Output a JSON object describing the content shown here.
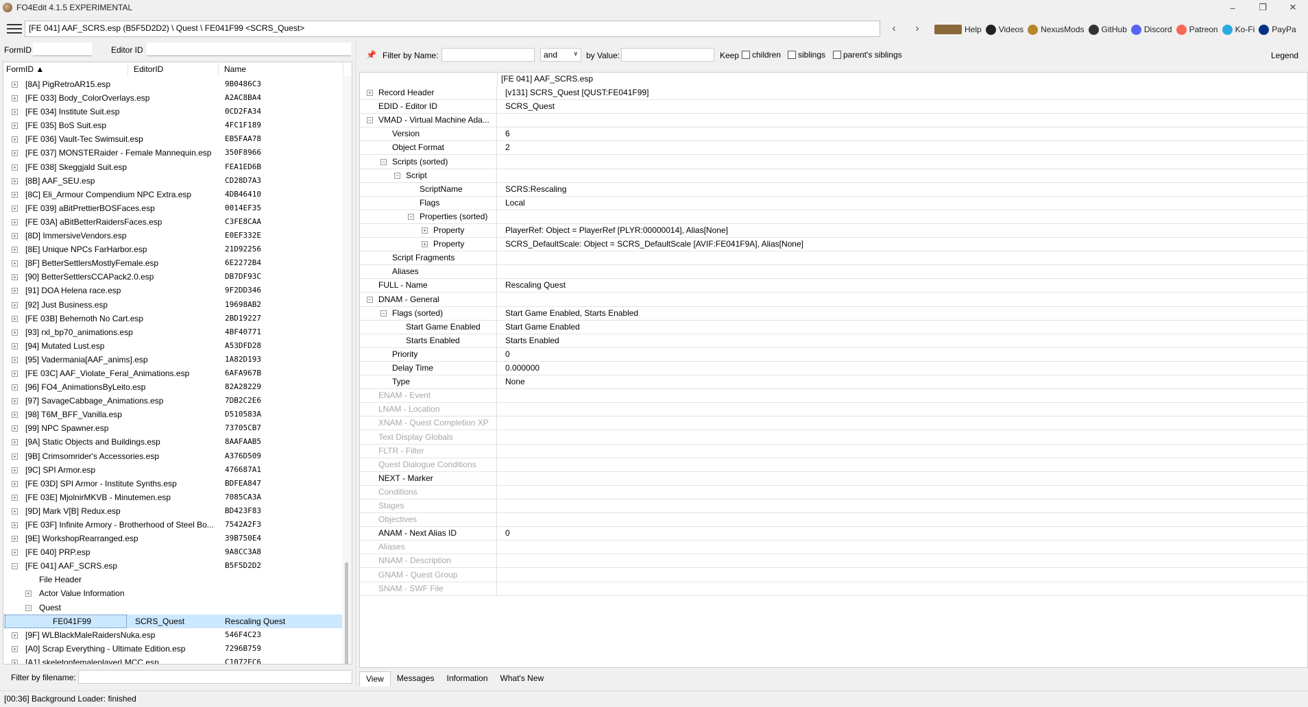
{
  "window": {
    "title": "FO4Edit 4.1.5 EXPERIMENTAL"
  },
  "pathbar": {
    "path": "[FE 041] AAF_SCRS.esp (B5F5D2D2) \\ Quest \\ FE041F99 <SCRS_Quest>"
  },
  "links": [
    {
      "label": "Help",
      "icon": "book-icon",
      "color": "#8a6a3a"
    },
    {
      "label": "Videos",
      "icon": "videos-icon",
      "color": "#222222"
    },
    {
      "label": "NexusMods",
      "icon": "nexusmods-icon",
      "color": "#b8862b"
    },
    {
      "label": "GitHub",
      "icon": "github-icon",
      "color": "#333333"
    },
    {
      "label": "Discord",
      "icon": "discord-icon",
      "color": "#5865f2"
    },
    {
      "label": "Patreon",
      "icon": "patreon-icon",
      "color": "#f96854"
    },
    {
      "label": "Ko-Fi",
      "icon": "kofi-icon",
      "color": "#29abe0"
    },
    {
      "label": "PayPa",
      "icon": "paypal-icon",
      "color": "#003087"
    }
  ],
  "left": {
    "formid_label": "FormID",
    "editorid_label": "Editor ID",
    "columns": [
      "FormID",
      "EditorID",
      "Name"
    ],
    "rows": [
      {
        "name": "[8A] PigRetroAR15.esp",
        "hex": "9B0486C3"
      },
      {
        "name": "[FE 033] Body_ColorOverlays.esp",
        "hex": "A2AC8BA4"
      },
      {
        "name": "[FE 034] Institute Suit.esp",
        "hex": "0CD2FA34"
      },
      {
        "name": "[FE 035] BoS Suit.esp",
        "hex": "4FC1F189"
      },
      {
        "name": "[FE 036] Vault-Tec Swimsuit.esp",
        "hex": "EB5FAA78"
      },
      {
        "name": "[FE 037] MONSTERaider - Female Mannequin.esp",
        "hex": "350F8966"
      },
      {
        "name": "[FE 038] Skeggjald Suit.esp",
        "hex": "FEA1ED6B"
      },
      {
        "name": "[8B] AAF_SEU.esp",
        "hex": "CD28D7A3"
      },
      {
        "name": "[8C] Eli_Armour Compendium NPC Extra.esp",
        "hex": "4DB46410"
      },
      {
        "name": "[FE 039] aBitPrettierBOSFaces.esp",
        "hex": "0014EF35"
      },
      {
        "name": "[FE 03A] aBitBetterRaidersFaces.esp",
        "hex": "C3FE8CAA"
      },
      {
        "name": "[8D] ImmersiveVendors.esp",
        "hex": "E0EF332E"
      },
      {
        "name": "[8E] Unique NPCs FarHarbor.esp",
        "hex": "21D92256"
      },
      {
        "name": "[8F] BetterSettlersMostlyFemale.esp",
        "hex": "6E2272B4"
      },
      {
        "name": "[90] BetterSettlersCCAPack2.0.esp",
        "hex": "DB7DF93C"
      },
      {
        "name": "[91] DOA Helena race.esp",
        "hex": "9F2DD346"
      },
      {
        "name": "[92] Just Business.esp",
        "hex": "19698AB2"
      },
      {
        "name": "[FE 03B] Behemoth No Cart.esp",
        "hex": "2BD19227"
      },
      {
        "name": "[93] rxl_bp70_animations.esp",
        "hex": "4BF40771"
      },
      {
        "name": "[94] Mutated Lust.esp",
        "hex": "A53DFD28"
      },
      {
        "name": "[95] Vadermania[AAF_anims].esp",
        "hex": "1A82D193"
      },
      {
        "name": "[FE 03C] AAF_Violate_Feral_Animations.esp",
        "hex": "6AFA967B"
      },
      {
        "name": "[96] FO4_AnimationsByLeito.esp",
        "hex": "82A28229"
      },
      {
        "name": "[97] SavageCabbage_Animations.esp",
        "hex": "7DB2C2E6"
      },
      {
        "name": "[98] T6M_BFF_Vanilla.esp",
        "hex": "D510583A"
      },
      {
        "name": "[99] NPC Spawner.esp",
        "hex": "73705CB7"
      },
      {
        "name": "[9A] Static Objects and Buildings.esp",
        "hex": "8AAFAAB5"
      },
      {
        "name": "[9B] Crimsomrider's Accessories.esp",
        "hex": "A376D509"
      },
      {
        "name": "[9C] SPI Armor.esp",
        "hex": "476687A1"
      },
      {
        "name": "[FE 03D] SPI Armor - Institute Synths.esp",
        "hex": "BDFEA847"
      },
      {
        "name": "[FE 03E] MjolnirMKVB - Minutemen.esp",
        "hex": "7085CA3A"
      },
      {
        "name": "[9D] Mark V[B] Redux.esp",
        "hex": "BD423F83"
      },
      {
        "name": "[FE 03F] Infinite Armory - Brotherhood of Steel Bo...",
        "hex": "7542A2F3"
      },
      {
        "name": "[9E] WorkshopRearranged.esp",
        "hex": "39B750E4"
      },
      {
        "name": "[FE 040] PRP.esp",
        "hex": "9A8CC3A8"
      },
      {
        "name": "[FE 041] AAF_SCRS.esp",
        "hex": "B5F5D2D2"
      }
    ],
    "children": {
      "file_header": "File Header",
      "actor_value": "Actor Value Information",
      "quest": "Quest",
      "selected": {
        "formid": "FE041F99",
        "editorid": "SCRS_Quest",
        "name": "Rescaling Quest"
      }
    },
    "rows_after": [
      {
        "name": "[9F] WLBlackMaleRaidersNuka.esp",
        "hex": "546F4C23"
      },
      {
        "name": "[A0] Scrap Everything - Ultimate Edition.esp",
        "hex": "7296B759"
      },
      {
        "name": "[A1] skeletonfemaleplayerLMCC.esp",
        "hex": "C1072EC6"
      }
    ],
    "file_filter_label": "Filter by filename:"
  },
  "right": {
    "filter_name_label": "Filter by Name:",
    "and_value": "and",
    "by_value_label": "by Value:",
    "keep_label": "Keep",
    "children_label": "children",
    "siblings_label": "siblings",
    "parents_label": "parent's siblings",
    "legend_label": "Legend",
    "file_name": "[FE 041] AAF_SCRS.esp",
    "records": [
      {
        "label": "Record Header",
        "value": "[v131] SCRS_Quest [QUST:FE041F99]",
        "indent": 0,
        "exp": "+"
      },
      {
        "label": "EDID - Editor ID",
        "value": "SCRS_Quest",
        "indent": 0
      },
      {
        "label": "VMAD - Virtual Machine Ada...",
        "value": "",
        "indent": 0,
        "exp": "-"
      },
      {
        "label": "Version",
        "value": "6",
        "indent": 1
      },
      {
        "label": "Object Format",
        "value": "2",
        "indent": 1
      },
      {
        "label": "Scripts (sorted)",
        "value": "",
        "indent": 1,
        "exp": "-"
      },
      {
        "label": "Script",
        "value": "",
        "indent": 2,
        "exp": "-"
      },
      {
        "label": "ScriptName",
        "value": "SCRS:Rescaling",
        "indent": 3
      },
      {
        "label": "Flags",
        "value": "Local",
        "indent": 3
      },
      {
        "label": "Properties (sorted)",
        "value": "",
        "indent": 3,
        "exp": "-"
      },
      {
        "label": "Property",
        "value": "PlayerRef: Object = PlayerRef [PLYR:00000014], Alias[None]",
        "indent": 4,
        "exp": "+"
      },
      {
        "label": "Property",
        "value": "SCRS_DefaultScale: Object = SCRS_DefaultScale [AVIF:FE041F9A], Alias[None]",
        "indent": 4,
        "exp": "+"
      },
      {
        "label": "Script Fragments",
        "value": "",
        "indent": 1
      },
      {
        "label": "Aliases",
        "value": "",
        "indent": 1
      },
      {
        "label": "FULL - Name",
        "value": "Rescaling Quest",
        "indent": 0
      },
      {
        "label": "DNAM - General",
        "value": "",
        "indent": 0,
        "exp": "-"
      },
      {
        "label": "Flags (sorted)",
        "value": "Start Game Enabled, Starts Enabled",
        "indent": 1,
        "exp": "-"
      },
      {
        "label": "Start Game Enabled",
        "value": "Start Game Enabled",
        "indent": 2
      },
      {
        "label": "Starts Enabled",
        "value": "Starts Enabled",
        "indent": 2
      },
      {
        "label": "Priority",
        "value": "0",
        "indent": 1
      },
      {
        "label": "Delay Time",
        "value": "0.000000",
        "indent": 1
      },
      {
        "label": "Type",
        "value": "None",
        "indent": 1
      },
      {
        "label": "ENAM - Event",
        "value": "",
        "indent": 0,
        "dim": true
      },
      {
        "label": "LNAM - Location",
        "value": "",
        "indent": 0,
        "dim": true
      },
      {
        "label": "XNAM - Quest Completion XP",
        "value": "",
        "indent": 0,
        "dim": true
      },
      {
        "label": "Text Display Globals",
        "value": "",
        "indent": 0,
        "dim": true
      },
      {
        "label": "FLTR - Filter",
        "value": "",
        "indent": 0,
        "dim": true
      },
      {
        "label": "Quest Dialogue Conditions",
        "value": "",
        "indent": 0,
        "dim": true
      },
      {
        "label": "NEXT - Marker",
        "value": "",
        "indent": 0
      },
      {
        "label": "Conditions",
        "value": "",
        "indent": 0,
        "dim": true
      },
      {
        "label": "Stages",
        "value": "",
        "indent": 0,
        "dim": true
      },
      {
        "label": "Objectives",
        "value": "",
        "indent": 0,
        "dim": true
      },
      {
        "label": "ANAM - Next Alias ID",
        "value": "0",
        "indent": 0
      },
      {
        "label": "Aliases",
        "value": "",
        "indent": 0,
        "dim": true
      },
      {
        "label": "NNAM - Description",
        "value": "",
        "indent": 0,
        "dim": true
      },
      {
        "label": "GNAM - Quest Group",
        "value": "",
        "indent": 0,
        "dim": true
      },
      {
        "label": "SNAM - SWF File",
        "value": "",
        "indent": 0,
        "dim": true
      }
    ],
    "tabs": [
      "View",
      "Messages",
      "Information",
      "What's New"
    ]
  },
  "status": {
    "text": "[00:36] Background Loader: finished"
  }
}
